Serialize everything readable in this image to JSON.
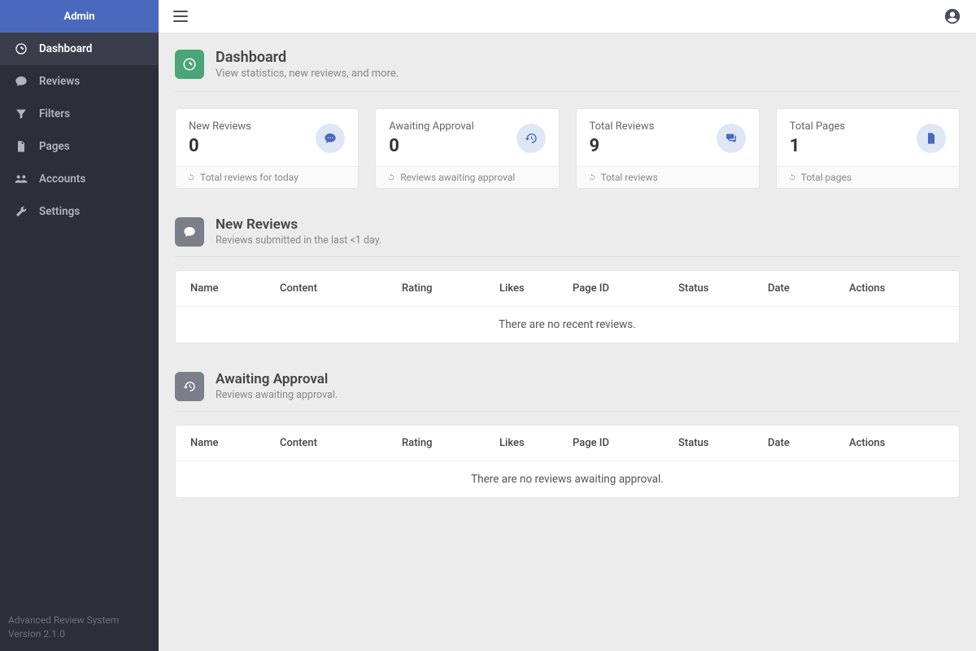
{
  "brand": "Admin",
  "sidebar": {
    "items": [
      {
        "label": "Dashboard"
      },
      {
        "label": "Reviews"
      },
      {
        "label": "Filters"
      },
      {
        "label": "Pages"
      },
      {
        "label": "Accounts"
      },
      {
        "label": "Settings"
      }
    ]
  },
  "footer": {
    "product": "Advanced Review System",
    "version": "Version 2.1.0"
  },
  "page": {
    "title": "Dashboard",
    "desc": "View statistics, new reviews, and more."
  },
  "stats": [
    {
      "label": "New Reviews",
      "value": "0",
      "foot": "Total reviews for today"
    },
    {
      "label": "Awaiting Approval",
      "value": "0",
      "foot": "Reviews awaiting approval"
    },
    {
      "label": "Total Reviews",
      "value": "9",
      "foot": "Total reviews"
    },
    {
      "label": "Total Pages",
      "value": "1",
      "foot": "Total pages"
    }
  ],
  "columns": {
    "name": "Name",
    "content": "Content",
    "rating": "Rating",
    "likes": "Likes",
    "page": "Page ID",
    "status": "Status",
    "date": "Date",
    "actions": "Actions"
  },
  "sections": {
    "new": {
      "title": "New Reviews",
      "desc": "Reviews submitted in the last <1 day.",
      "empty": "There are no recent reviews."
    },
    "awaiting": {
      "title": "Awaiting Approval",
      "desc": "Reviews awaiting approval.",
      "empty": "There are no reviews awaiting approval."
    }
  }
}
